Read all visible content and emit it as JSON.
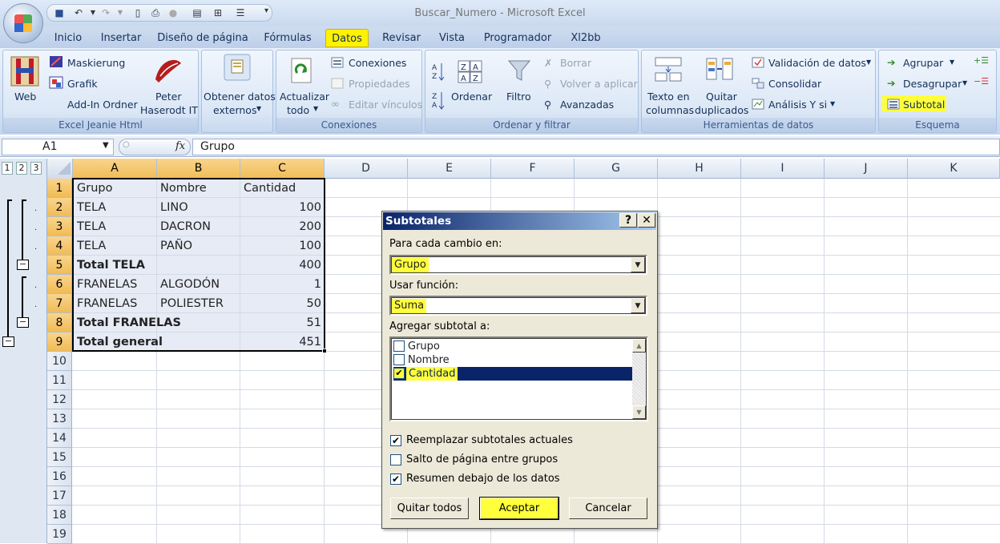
{
  "window": {
    "title": "Buscar_Numero - Microsoft Excel"
  },
  "tabs": [
    {
      "label": "Inicio"
    },
    {
      "label": "Insertar"
    },
    {
      "label": "Diseño de página"
    },
    {
      "label": "Fórmulas"
    },
    {
      "label": "Datos",
      "active": true
    },
    {
      "label": "Revisar"
    },
    {
      "label": "Vista"
    },
    {
      "label": "Programador"
    },
    {
      "label": "Xl2bb"
    }
  ],
  "ribbon": {
    "g1": {
      "title": "Excel Jeanie Html",
      "web": "Web",
      "maskierung": "Maskierung",
      "grafik": "Grafik",
      "addin": "Add-In Ordner",
      "peter1": "Peter",
      "peter2": "Haserodt IT"
    },
    "g2": {
      "line1": "Obtener datos",
      "line2": "externos"
    },
    "g3": {
      "title": "Conexiones",
      "actualizar1": "Actualizar",
      "actualizar2": "todo",
      "conexiones": "Conexiones",
      "propiedades": "Propiedades",
      "editar": "Editar vínculos"
    },
    "g4": {
      "title": "Ordenar y filtrar",
      "ordenar": "Ordenar",
      "filtro": "Filtro",
      "borrar": "Borrar",
      "volver": "Volver a aplicar",
      "avanzadas": "Avanzadas"
    },
    "g5": {
      "title": "Herramientas de datos",
      "texto1": "Texto en",
      "texto2": "columnas",
      "quitar1": "Quitar",
      "quitar2": "duplicados",
      "validacion": "Validación de datos",
      "consolidar": "Consolidar",
      "analisis": "Análisis Y si"
    },
    "g6": {
      "title": "Esquema",
      "agrupar": "Agrupar",
      "desagrupar": "Desagrupar",
      "subtotal": "Subtotal"
    }
  },
  "formula_bar": {
    "name_box": "A1",
    "fx": "fx",
    "content": "Grupo"
  },
  "outline_levels": [
    "1",
    "2",
    "3"
  ],
  "columns": [
    "A",
    "B",
    "C",
    "D",
    "E",
    "F",
    "G",
    "H",
    "I",
    "J",
    "K"
  ],
  "rows": [
    "1",
    "2",
    "3",
    "4",
    "5",
    "6",
    "7",
    "8",
    "9",
    "10",
    "11",
    "12",
    "13",
    "14",
    "15",
    "16",
    "17",
    "18",
    "19"
  ],
  "sheet_data": [
    {
      "a": "Grupo",
      "b": "Nombre",
      "c": "Cantidad"
    },
    {
      "a": "TELA",
      "b": "LINO",
      "c": "100"
    },
    {
      "a": "TELA",
      "b": "DACRON",
      "c": "200"
    },
    {
      "a": "TELA",
      "b": "PAÑO",
      "c": "100"
    },
    {
      "a": "Total TELA",
      "b": "",
      "c": "400"
    },
    {
      "a": "FRANELAS",
      "b": "ALGODÓN",
      "c": "1"
    },
    {
      "a": "FRANELAS",
      "b": "POLIESTER",
      "c": "50"
    },
    {
      "a": "Total FRANELAS",
      "b": "",
      "c": "51"
    },
    {
      "a": "Total general",
      "b": "",
      "c": "451"
    }
  ],
  "dialog": {
    "title": "Subtotales",
    "help": "?",
    "close": "✕",
    "label_cambio": "Para cada cambio en:",
    "cambio_value": "Grupo",
    "label_funcion": "Usar función:",
    "funcion_value": "Suma",
    "label_agregar": "Agregar subtotal a:",
    "list_items": [
      {
        "label": "Grupo",
        "checked": false
      },
      {
        "label": "Nombre",
        "checked": false
      },
      {
        "label": "Cantidad",
        "checked": true
      }
    ],
    "options": [
      {
        "label": "Reemplazar subtotales actuales",
        "checked": true
      },
      {
        "label": "Salto de página entre grupos",
        "checked": false
      },
      {
        "label": "Resumen debajo de los datos",
        "checked": true
      }
    ],
    "btn_quitar": "Quitar todos",
    "btn_aceptar": "Aceptar",
    "btn_cancelar": "Cancelar"
  },
  "colors": {
    "highlight": "#ffff3b",
    "selection": "#0a246a",
    "tab_active": "#fff200"
  }
}
